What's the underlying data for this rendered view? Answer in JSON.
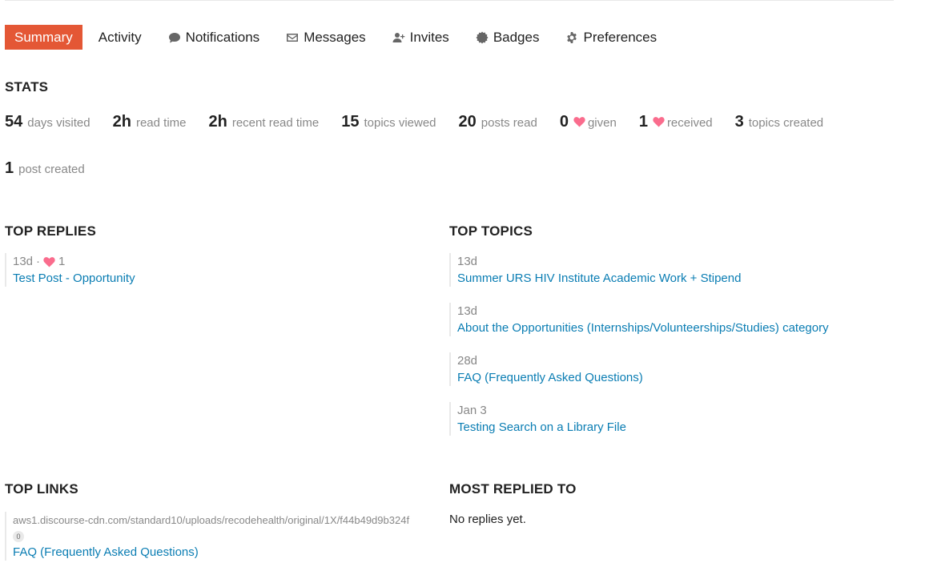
{
  "nav": {
    "summary": "Summary",
    "activity": "Activity",
    "notifications": "Notifications",
    "messages": "Messages",
    "invites": "Invites",
    "badges": "Badges",
    "preferences": "Preferences",
    "accent_color": "#e45735"
  },
  "stats": {
    "heading": "STATS",
    "items": [
      {
        "num": "54",
        "label": "days visited"
      },
      {
        "num": "2h",
        "label": "read time"
      },
      {
        "num": "2h",
        "label": "recent read time"
      },
      {
        "num": "15",
        "label": "topics viewed"
      },
      {
        "num": "20",
        "label": "posts read"
      },
      {
        "num": "0",
        "label": "given",
        "icon": "heart-icon"
      },
      {
        "num": "1",
        "label": "received",
        "icon": "heart-icon"
      },
      {
        "num": "3",
        "label": "topics created"
      },
      {
        "num": "1",
        "label": "post created"
      }
    ]
  },
  "top_replies": {
    "heading": "TOP REPLIES",
    "items": [
      {
        "age": "13d",
        "sep": "·",
        "likes": "1",
        "title": "Test Post - Opportunity"
      }
    ]
  },
  "top_topics": {
    "heading": "TOP TOPICS",
    "items": [
      {
        "age": "13d",
        "title": "Summer URS HIV Institute Academic Work + Stipend"
      },
      {
        "age": "13d",
        "title": "About the Opportunities (Internships/Volunteerships/Studies) category"
      },
      {
        "age": "28d",
        "title": "FAQ (Frequently Asked Questions)"
      },
      {
        "age": "Jan 3",
        "title": "Testing Search on a Library File"
      }
    ]
  },
  "top_links": {
    "heading": "TOP LINKS",
    "items": [
      {
        "url": "aws1.discourse-cdn.com/standard10/uploads/recodehealth/original/1X/f44b49d9b324f",
        "clicks": "0",
        "title": "FAQ (Frequently Asked Questions)"
      }
    ]
  },
  "most_replied": {
    "heading": "MOST REPLIED TO",
    "empty": "No replies yet."
  },
  "colors": {
    "link": "#0a7db3",
    "heart": "#fa6c8d",
    "muted": "#888888"
  }
}
